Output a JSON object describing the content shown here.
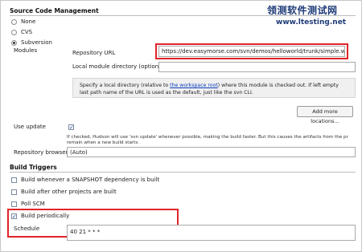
{
  "scm": {
    "section_title": "Source Code Management",
    "options": [
      "None",
      "CVS",
      "Subversion"
    ],
    "selected": "Subversion",
    "modules_label": "Modules",
    "repo_url_label": "Repository URL",
    "repo_url_value": "https://dev.easymorse.com/svn/demos/helloworld/trunk/simple.web",
    "local_dir_label": "Local module directory (optional)",
    "local_dir_value": "",
    "help_text_1": "Specify a local directory (relative to ",
    "help_link": "the workspace root",
    "help_text_2": ") where this module is checked out. If left empty",
    "help_text_3": "last path name of the URL is used as the default, just like the svn CLI.",
    "add_locations_button": "Add more locations...",
    "use_update_label": "Use update",
    "use_update_checked": true,
    "use_update_help_1": "If checked, Hudson will use 'svn update' whenever possible, making the build faster. But this causes the artifacts from the pr",
    "use_update_help_2": "remain when a new build starts.",
    "repo_browser_label": "Repository browser",
    "repo_browser_value": "(Auto)"
  },
  "triggers": {
    "section_title": "Build Triggers",
    "items": [
      {
        "label": "Build whenever a SNAPSHOT dependency is built",
        "checked": false
      },
      {
        "label": "Build after other projects are built",
        "checked": false
      },
      {
        "label": "Poll SCM",
        "checked": false
      },
      {
        "label": "Build periodically",
        "checked": true
      }
    ],
    "schedule_label": "Schedule",
    "schedule_value": "40 21 * * *"
  },
  "watermark": {
    "line1": "领测软件测试网",
    "line2": "www.ltesting.net"
  },
  "colors": {
    "highlight": "#e0242a",
    "link": "#0a3dbb",
    "watermark": "#1e3b78"
  }
}
